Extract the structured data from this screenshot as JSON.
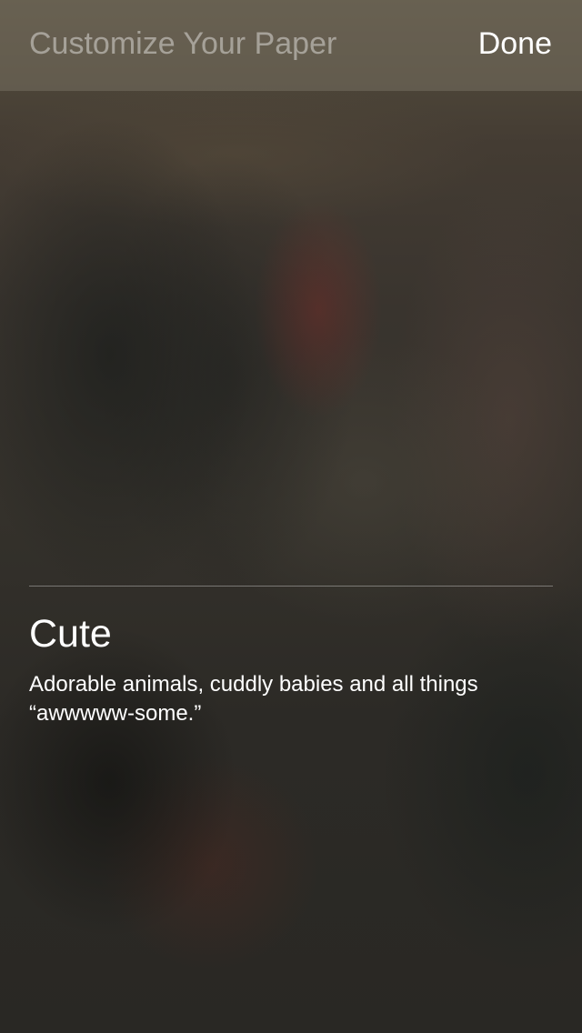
{
  "header": {
    "title": "Customize Your Paper",
    "done_label": "Done"
  },
  "category": {
    "title": "Cute",
    "description": "Adorable animals, cuddly babies and all things “awwwww-some.”"
  }
}
